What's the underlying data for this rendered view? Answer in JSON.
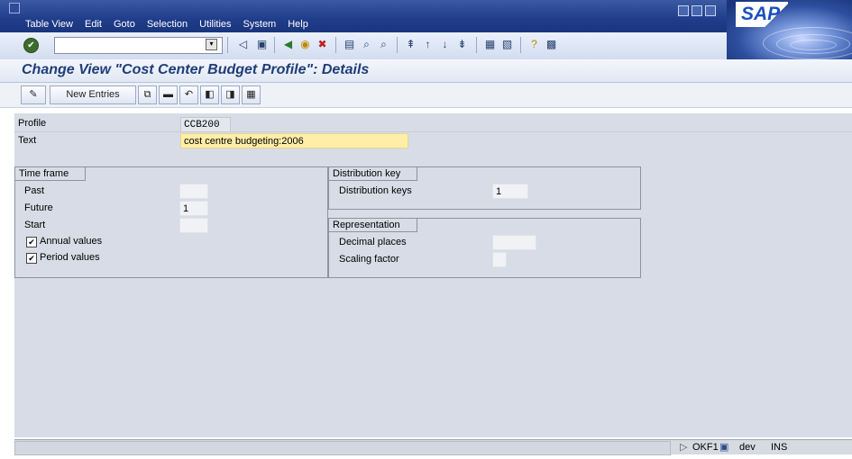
{
  "menubar": {
    "items": [
      "Table View",
      "Edit",
      "Goto",
      "Selection",
      "Utilities",
      "System",
      "Help"
    ]
  },
  "logo": {
    "text": "SAP"
  },
  "title": "Change View \"Cost Center Budget Profile\": Details",
  "app_toolbar": {
    "new_entries": "New Entries"
  },
  "form": {
    "profile_label": "Profile",
    "profile_value": "CCB200",
    "text_label": "Text",
    "text_value": "cost centre budgeting:2006"
  },
  "time_frame": {
    "title": "Time frame",
    "past_label": "Past",
    "past_value": "",
    "future_label": "Future",
    "future_value": "1",
    "start_label": "Start",
    "start_value": "",
    "annual_label": "Annual values",
    "annual_checked": true,
    "period_label": "Period values",
    "period_checked": true
  },
  "distribution_key": {
    "title": "Distribution key",
    "keys_label": "Distribution keys",
    "keys_value": "1"
  },
  "representation": {
    "title": "Representation",
    "decimal_label": "Decimal places",
    "decimal_value": "",
    "scaling_label": "Scaling factor",
    "scaling_value": ""
  },
  "statusbar": {
    "transaction": "OKF1",
    "system": "dev",
    "mode": "INS"
  }
}
